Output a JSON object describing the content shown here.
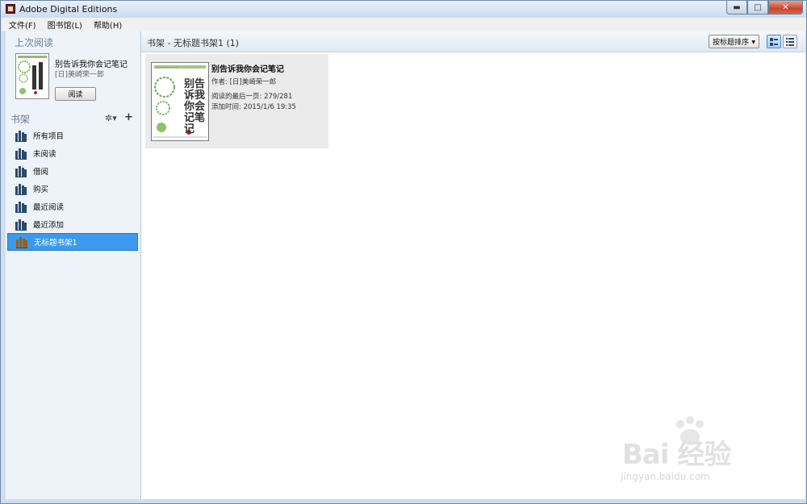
{
  "window": {
    "title": "Adobe Digital Editions",
    "controls": {
      "minimize": "▬",
      "maximize": "□",
      "close": "✕"
    }
  },
  "menu": [
    {
      "label": "文件(F)"
    },
    {
      "label": "图书馆(L)"
    },
    {
      "label": "帮助(H)"
    }
  ],
  "sidebar": {
    "last_read_title": "上次阅读",
    "last_read": {
      "book_title": "别告诉我你会记笔记",
      "author": "[日]美崎荣一郎",
      "read_button": "阅读"
    },
    "shelves_title": "书架",
    "shelf_items": [
      {
        "label": "所有项目",
        "selected": false
      },
      {
        "label": "未阅读",
        "selected": false
      },
      {
        "label": "借阅",
        "selected": false
      },
      {
        "label": "购买",
        "selected": false
      },
      {
        "label": "最近阅读",
        "selected": false
      },
      {
        "label": "最近添加",
        "selected": false
      },
      {
        "label": "无标题书架1",
        "selected": true
      }
    ]
  },
  "main": {
    "header_title": "书架 - 无标题书架1 (1)",
    "sort_label": "按标题排序",
    "books": [
      {
        "title": "别告诉我你会记笔记",
        "author_line": "作者: [日]美崎荣一郎",
        "progress_line": "阅读的最后一页: 279/281",
        "added_line": "添加时间: 2015/1/6 19:35",
        "cover_text": "别告诉我你会记笔记"
      }
    ]
  },
  "watermark": {
    "main": "Bai 经验",
    "sub": "jingyan.baidu.com"
  },
  "colors": {
    "selected": "#3b9aee",
    "sidebar_bg": "#eef3f9",
    "card_bg": "#ebebeb"
  }
}
